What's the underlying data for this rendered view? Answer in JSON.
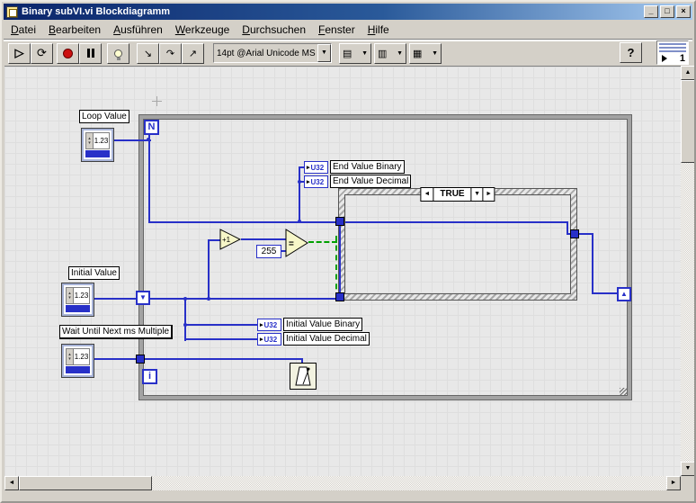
{
  "window": {
    "title": "Binary subVI.vi Blockdiagramm",
    "controls": {
      "minimize": "_",
      "maximize": "□",
      "close": "×"
    }
  },
  "menu": [
    "Datei",
    "Bearbeiten",
    "Ausführen",
    "Werkzeuge",
    "Durchsuchen",
    "Fenster",
    "Hilfe"
  ],
  "toolbar": {
    "run": "▷",
    "run_continuous": "⟳",
    "step_into": "↘",
    "step_over": "↷",
    "step_out": "↗",
    "font_selector": "14pt @Arial Unicode MS",
    "dropdown": "▼",
    "align_icon": "▤",
    "distribute_icon": "▥",
    "reorder_icon": "▦",
    "help": "?",
    "vi_icon_number": "1"
  },
  "scrollbar": {
    "up": "▲",
    "down": "▼",
    "left": "◄",
    "right": "►"
  },
  "diagram": {
    "labels": {
      "loop_value": "Loop Value",
      "initial_value": "Initial Value",
      "wait": "Wait Until Next ms Multiple",
      "end_value_binary": "End Value Binary",
      "end_value_decimal": "End Value Decimal",
      "initial_value_binary": "Initial Value Binary",
      "initial_value_decimal": "Initial Value Decimal"
    },
    "terminals": {
      "loop_count": "N",
      "iteration": "i",
      "type": "U32",
      "arrow": "▸"
    },
    "numeric_display": "1.23",
    "spin_up": "▴",
    "spin_down": "▾",
    "constant_255": "255",
    "increment": "+1",
    "comparison": "=",
    "case": {
      "selector": "TRUE",
      "prev": "◄",
      "next": "►",
      "dropdown": "▼"
    },
    "shift_register": {
      "down": "▼",
      "up": "▲"
    },
    "colors": {
      "wire_int": "#2830c8",
      "wire_bool": "#00a000"
    }
  }
}
